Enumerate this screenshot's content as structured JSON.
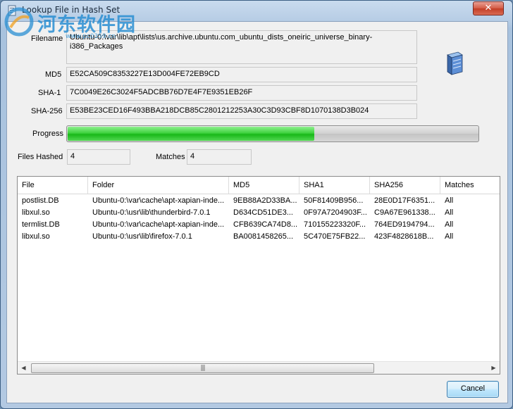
{
  "window": {
    "title": "Lookup File in Hash Set",
    "close_glyph": "✕"
  },
  "watermark": {
    "text": "河东软件园",
    "subtext": "www.pc0359.cn"
  },
  "form": {
    "filename_label": "Filename",
    "filename_value": "Ubuntu-0:\\var\\lib\\apt\\lists\\us.archive.ubuntu.com_ubuntu_dists_oneiric_universe_binary-i386_Packages",
    "md5_label": "MD5",
    "md5_value": "E52CA509C8353227E13D004FE72EB9CD",
    "sha1_label": "SHA-1",
    "sha1_value": "7C0049E26C3024F5ADCBB76D7E4F7E9351EB26F",
    "sha256_label": "SHA-256",
    "sha256_value": "E53BE23CED16F493BBA218DCB85C2801212253A30C3D93CBF8D1070138D3B024",
    "progress_label": "Progress",
    "progress_fraction": 0.6,
    "files_hashed_label": "Files Hashed",
    "files_hashed_value": "4",
    "matches_label": "Matches",
    "matches_value": "4"
  },
  "table": {
    "columns": [
      "File",
      "Folder",
      "MD5",
      "SHA1",
      "SHA256",
      "Matches"
    ],
    "rows": [
      [
        "postlist.DB",
        "Ubuntu-0:\\var\\cache\\apt-xapian-inde...",
        "9EB88A2D33BA...",
        "50F81409B956...",
        "28E0D17F6351...",
        "All"
      ],
      [
        "libxul.so",
        "Ubuntu-0:\\usr\\lib\\thunderbird-7.0.1",
        "D634CD51DE3...",
        "0F97A7204903F...",
        "C9A67E961338...",
        "All"
      ],
      [
        "termlist.DB",
        "Ubuntu-0:\\var\\cache\\apt-xapian-inde...",
        "CFB639CA74D8...",
        "710155223320F...",
        "764ED9194794...",
        "All"
      ],
      [
        "libxul.so",
        "Ubuntu-0:\\usr\\lib\\firefox-7.0.1",
        "BA0081458265...",
        "5C470E75FB22...",
        "423F4828618B...",
        "All"
      ]
    ],
    "scroll_left": "◀",
    "scroll_right": "▶",
    "scroll_grip": "|||"
  },
  "buttons": {
    "cancel": "Cancel"
  },
  "colors": {
    "progress_green": "#18b818",
    "accent": "#3c7fb1"
  },
  "icons": [
    "app-icon",
    "close-icon",
    "server-icon"
  ]
}
